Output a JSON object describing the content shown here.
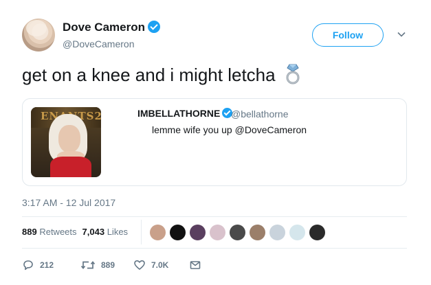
{
  "author": {
    "name": "Dove Cameron",
    "handle": "@DoveCameron",
    "verified": true
  },
  "follow_button": {
    "label": "Follow"
  },
  "tweet": {
    "text": "get on a knee and i might letcha",
    "emoji": "ring-emoji"
  },
  "quoted_tweet": {
    "name": "IMBELLATHORNE",
    "verified": true,
    "handle": "@bellathorne",
    "text": "lemme wife you up @DoveCameron",
    "image_caption": "ENANTS2"
  },
  "timestamp": "3:17 AM - 12 Jul 2017",
  "stats": {
    "retweets_count": "889",
    "retweets_label": "Retweets",
    "likes_count": "7,043",
    "likes_label": "Likes"
  },
  "liker_avatars": [
    {
      "color": "#c9a08a"
    },
    {
      "color": "#111111"
    },
    {
      "color": "#5a3f5f"
    },
    {
      "color": "#d9c2cc"
    },
    {
      "color": "#4a4a4a"
    },
    {
      "color": "#9b7f6a"
    },
    {
      "color": "#c9d3dc"
    },
    {
      "color": "#d5e6ec"
    },
    {
      "color": "#2a2a2a"
    }
  ],
  "actions": {
    "replies": "212",
    "retweets": "889",
    "likes": "7.0K"
  },
  "colors": {
    "accent": "#1da1f2",
    "text": "#14171a",
    "secondary": "#657786",
    "border": "#e1e8ed"
  }
}
